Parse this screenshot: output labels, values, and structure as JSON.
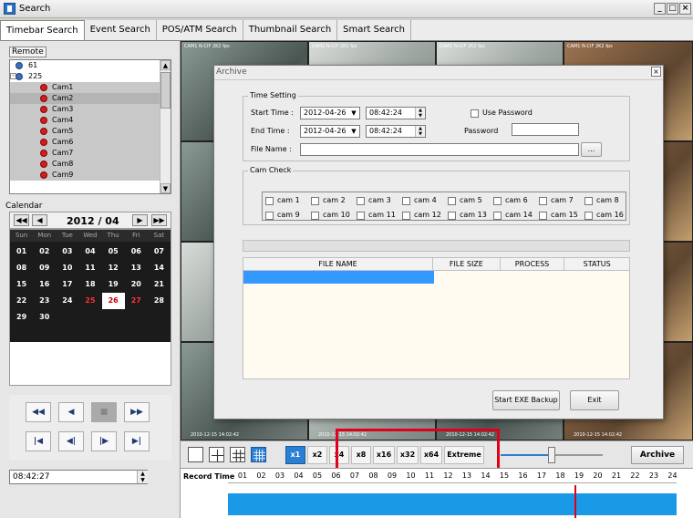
{
  "window": {
    "title": "Search"
  },
  "tabs": [
    "Timebar Search",
    "Event Search",
    "POS/ATM Search",
    "Thumbnail Search",
    "Smart Search"
  ],
  "left": {
    "remote_label": "Remote",
    "tree": {
      "nodes": [
        "61",
        "225"
      ],
      "cameras": [
        "Cam1",
        "Cam2",
        "Cam3",
        "Cam4",
        "Cam5",
        "Cam6",
        "Cam7",
        "Cam8",
        "Cam9"
      ]
    },
    "calendar": {
      "label": "Calendar",
      "month": "2012 / 04",
      "dow": [
        "Sun",
        "Mon",
        "Tue",
        "Wed",
        "Thu",
        "Fri",
        "Sat"
      ],
      "weeks": [
        [
          "01",
          "02",
          "03",
          "04",
          "05",
          "06",
          "07"
        ],
        [
          "08",
          "09",
          "10",
          "11",
          "12",
          "13",
          "14"
        ],
        [
          "15",
          "16",
          "17",
          "18",
          "19",
          "20",
          "21"
        ],
        [
          "22",
          "23",
          "24",
          "25",
          "26",
          "27",
          "28"
        ],
        [
          "29",
          "30",
          "",
          "",
          "",
          "",
          ""
        ]
      ],
      "selected_day": "26"
    },
    "time_value": "08:42:27"
  },
  "archive": {
    "title": "Archive",
    "time_setting_label": "Time Setting",
    "start_time_label": "Start Time :",
    "start_date": "2012-04-26",
    "start_time": "08:42:24",
    "end_time_label": "End Time :",
    "end_date": "2012-04-26",
    "end_time": "08:42:24",
    "file_name_label": "File Name :",
    "browse": "...",
    "use_password_label": "Use Password",
    "password_label": "Password",
    "cam_check_label": "Cam Check",
    "cam_row1": [
      "cam 1",
      "cam 2",
      "cam 3",
      "cam 4",
      "cam 5",
      "cam 6",
      "cam 7",
      "cam 8"
    ],
    "cam_row2": [
      "cam 9",
      "cam 10",
      "cam 11",
      "cam 12",
      "cam 13",
      "cam 14",
      "cam 15",
      "cam 16"
    ],
    "table_headers": [
      "FILE NAME",
      "FILE SIZE",
      "PROCESS",
      "STATUS"
    ],
    "start_backup": "Start EXE Backup",
    "exit": "Exit"
  },
  "toolbar": {
    "speeds": [
      "x1",
      "x2",
      "x4",
      "x8",
      "x16",
      "x32",
      "x64",
      "Extreme"
    ],
    "active_speed": "x1",
    "archive": "Archive"
  },
  "timeline": {
    "label": "Record Time",
    "hours": [
      "01",
      "02",
      "03",
      "04",
      "05",
      "06",
      "07",
      "08",
      "09",
      "10",
      "11",
      "12",
      "13",
      "14",
      "15",
      "16",
      "17",
      "18",
      "19",
      "20",
      "21",
      "22",
      "23",
      "24"
    ]
  },
  "video": {
    "tile_labels": [
      "CAM1 N-CIF 2K2 fps",
      "CAM1 N-CIF 2K2 fps",
      "CAM1 N-CIF 2K2 fps",
      "CAM1 N-CIF 2K2 fps"
    ],
    "timestamps": [
      "2010-12-15 14:02:42",
      "2010-12-15 14:02:42",
      "2010-12-15 14:02:42",
      "2010-12-15 14:02:42"
    ]
  },
  "colors": {
    "accent": "#2a7fd4",
    "highlight": "#e0001a",
    "timeline_bar": "#1a9ae6",
    "calendar_bg": "#1b1b1b"
  }
}
